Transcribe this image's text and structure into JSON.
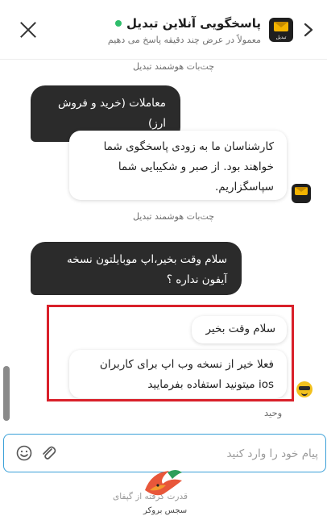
{
  "header": {
    "title": "پاسخگویی آنلاین تبدیل",
    "subtitle": "معمولاً در عرض چند دقیقه پاسخ می دهیم",
    "logo_text": "تبدیل",
    "status_color": "#2ebd6b"
  },
  "messages": {
    "bot_sender_label_1": "چت‌بات هوشمند تبدیل",
    "user_message_1": "معاملات (خرید و فروش ارز)",
    "bot_reply_1": "کارشناسان ما به زودی پاسخگوی شما خواهند بود. از صبر و شکیبایی شما سپاسگزاریم.",
    "bot_sender_label_2": "چت‌بات هوشمند تبدیل",
    "user_message_2": "سلام وقت بخیر،اپ موبایلتون نسخه آیفون نداره ؟",
    "agent_reply_1": "سلام وقت بخیر",
    "agent_reply_2": "فعلا خیر از نسخه وب اپ برای کاربران ios میتونید استفاده بفرمایید",
    "agent_name": "وحید"
  },
  "composer": {
    "placeholder": "پیام خود را وارد کنید",
    "emoji_icon": "smile-icon",
    "attach_icon": "paperclip-icon",
    "accent_color": "#3aa0d8"
  },
  "footer": {
    "powered_text": "قدرت گرفته از گپفای",
    "watermark_text": "سجس بروکر"
  },
  "colors": {
    "highlight": "#d9202a",
    "dark_bubble": "#2b2b2b",
    "brand_yellow": "#f4b400"
  }
}
